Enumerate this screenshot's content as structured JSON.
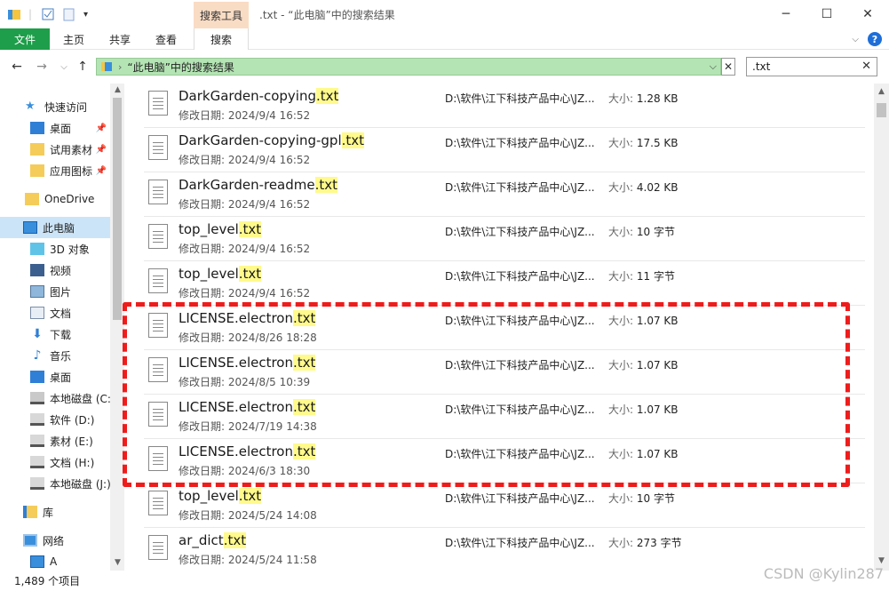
{
  "window": {
    "title": ".txt - “此电脑”中的搜索结果",
    "context_tab": "搜索工具"
  },
  "ribbon": {
    "tabs": [
      {
        "label": "文件"
      },
      {
        "label": "主页"
      },
      {
        "label": "共享"
      },
      {
        "label": "查看"
      },
      {
        "label": "搜索"
      }
    ],
    "help": "?"
  },
  "address": {
    "text": "“此电脑”中的搜索结果",
    "clear": "✕"
  },
  "search": {
    "value": ".txt",
    "clear": "✕"
  },
  "sidebar": {
    "items": [
      {
        "label": "快速访问",
        "icon": "star-icon"
      },
      {
        "label": "桌面",
        "icon": "desktop-icon",
        "pinned": true
      },
      {
        "label": "试用素材",
        "icon": "folder-icon",
        "pinned": true
      },
      {
        "label": "应用图标",
        "icon": "folder-icon",
        "pinned": true
      },
      {
        "label": "OneDrive",
        "icon": "folder-icon"
      },
      {
        "label": "此电脑",
        "icon": "computer-icon",
        "selected": true
      },
      {
        "label": "3D 对象",
        "icon": "cube-icon"
      },
      {
        "label": "视频",
        "icon": "video-icon"
      },
      {
        "label": "图片",
        "icon": "picture-icon"
      },
      {
        "label": "文档",
        "icon": "document-icon"
      },
      {
        "label": "下载",
        "icon": "download-icon"
      },
      {
        "label": "音乐",
        "icon": "music-icon"
      },
      {
        "label": "桌面",
        "icon": "desktop-icon"
      },
      {
        "label": "本地磁盘 (C:)",
        "icon": "drive-icon"
      },
      {
        "label": "软件 (D:)",
        "icon": "drive-icon"
      },
      {
        "label": "素材 (E:)",
        "icon": "drive-icon"
      },
      {
        "label": "文档 (H:)",
        "icon": "drive-icon"
      },
      {
        "label": "本地磁盘 (J:)",
        "icon": "drive-icon"
      },
      {
        "label": "库",
        "icon": "library-icon"
      },
      {
        "label": "网络",
        "icon": "network-icon"
      },
      {
        "label": "A",
        "icon": "computer-icon"
      }
    ]
  },
  "files": [
    {
      "base": "DarkGarden-copying",
      "ext": ".txt",
      "date_label": "修改日期:",
      "date": "2024/9/4 16:52",
      "path": "D:\\软件\\江下科技产品中心\\JZ...",
      "size_label": "大小:",
      "size": "1.28 KB"
    },
    {
      "base": "DarkGarden-copying-gpl",
      "ext": ".txt",
      "date_label": "修改日期:",
      "date": "2024/9/4 16:52",
      "path": "D:\\软件\\江下科技产品中心\\JZ...",
      "size_label": "大小:",
      "size": "17.5 KB"
    },
    {
      "base": "DarkGarden-readme",
      "ext": ".txt",
      "date_label": "修改日期:",
      "date": "2024/9/4 16:52",
      "path": "D:\\软件\\江下科技产品中心\\JZ...",
      "size_label": "大小:",
      "size": "4.02 KB"
    },
    {
      "base": "top_level",
      "ext": ".txt",
      "date_label": "修改日期:",
      "date": "2024/9/4 16:52",
      "path": "D:\\软件\\江下科技产品中心\\JZ...",
      "size_label": "大小:",
      "size": "10 字节"
    },
    {
      "base": "top_level",
      "ext": ".txt",
      "date_label": "修改日期:",
      "date": "2024/9/4 16:52",
      "path": "D:\\软件\\江下科技产品中心\\JZ...",
      "size_label": "大小:",
      "size": "11 字节"
    },
    {
      "base": "LICENSE.electron",
      "ext": ".txt",
      "date_label": "修改日期:",
      "date": "2024/8/26 18:28",
      "path": "D:\\软件\\江下科技产品中心\\JZ...",
      "size_label": "大小:",
      "size": "1.07 KB"
    },
    {
      "base": "LICENSE.electron",
      "ext": ".txt",
      "date_label": "修改日期:",
      "date": "2024/8/5 10:39",
      "path": "D:\\软件\\江下科技产品中心\\JZ...",
      "size_label": "大小:",
      "size": "1.07 KB"
    },
    {
      "base": "LICENSE.electron",
      "ext": ".txt",
      "date_label": "修改日期:",
      "date": "2024/7/19 14:38",
      "path": "D:\\软件\\江下科技产品中心\\JZ...",
      "size_label": "大小:",
      "size": "1.07 KB"
    },
    {
      "base": "LICENSE.electron",
      "ext": ".txt",
      "date_label": "修改日期:",
      "date": "2024/6/3 18:30",
      "path": "D:\\软件\\江下科技产品中心\\JZ...",
      "size_label": "大小:",
      "size": "1.07 KB"
    },
    {
      "base": "top_level",
      "ext": ".txt",
      "date_label": "修改日期:",
      "date": "2024/5/24 14:08",
      "path": "D:\\软件\\江下科技产品中心\\JZ...",
      "size_label": "大小:",
      "size": "10 字节"
    },
    {
      "base": "ar_dict",
      "ext": ".txt",
      "date_label": "修改日期:",
      "date": "2024/5/24 11:58",
      "path": "D:\\软件\\江下科技产品中心\\JZ...",
      "size_label": "大小:",
      "size": "273 字节"
    }
  ],
  "status": {
    "text": "1,489 个项目"
  },
  "watermark": "CSDN @Kylin287",
  "colors": {
    "file_tab": "#1e9e4a",
    "context_tab": "#f9dcc4",
    "address_bg": "#b4e4b4",
    "selected": "#cce4f7",
    "highlight": "#fffa8b",
    "annotation": "#ef1c1c"
  }
}
